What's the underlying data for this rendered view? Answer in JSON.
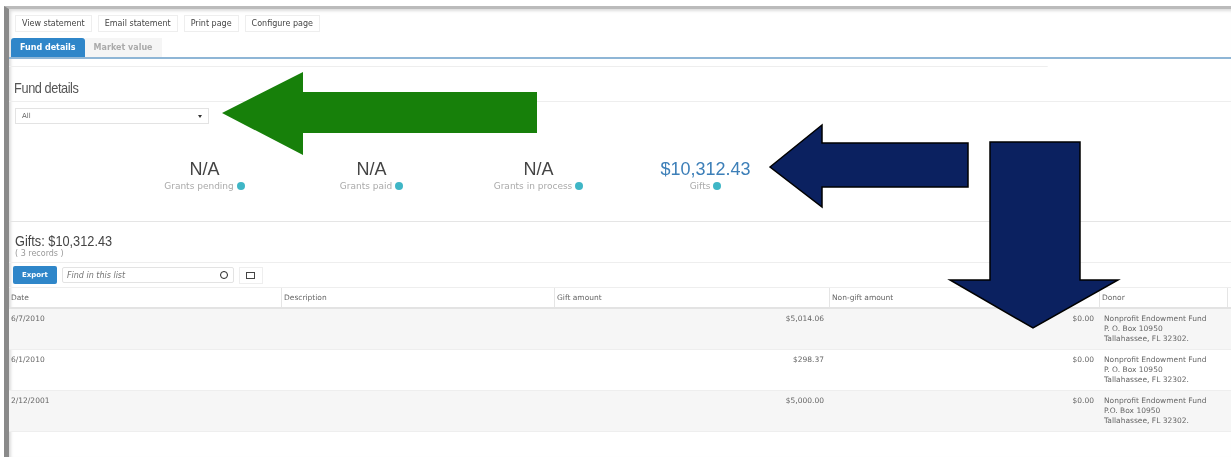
{
  "toolbar": [
    "View statement",
    "Email statement",
    "Print page",
    "Configure page"
  ],
  "tabs": [
    {
      "label": "Fund details",
      "selected": true
    },
    {
      "label": "Market value",
      "selected": false
    }
  ],
  "section_title": "Fund details",
  "filter": {
    "value": "All"
  },
  "summary": [
    {
      "value": "N/A",
      "label": "Grants pending",
      "highlight": false
    },
    {
      "value": "N/A",
      "label": "Grants paid",
      "highlight": false
    },
    {
      "value": "N/A",
      "label": "Grants in process",
      "highlight": false
    },
    {
      "value": "$10,312.43",
      "label": "Gifts",
      "highlight": true
    }
  ],
  "list": {
    "title": "Gifts: $10,312.43",
    "count": "( 3 records )",
    "export": "Export",
    "search": {
      "placeholder": "Find in this list"
    }
  },
  "table": {
    "columns": [
      "Date",
      "Description",
      "Gift amount",
      "Non-gift amount",
      "Donor"
    ],
    "rows": [
      {
        "date": "6/7/2010",
        "gift": "$5,014.06",
        "nongift": "$0.00",
        "donor": [
          "Nonprofit Endowment Fund",
          "P. O. Box 10950",
          "Tallahassee, FL 32302."
        ]
      },
      {
        "date": "6/1/2010",
        "gift": "$298.37",
        "nongift": "$0.00",
        "donor": [
          "Nonprofit Endowment Fund",
          "P. O. Box 10950",
          "Tallahassee, FL 32302."
        ]
      },
      {
        "date": "2/12/2001",
        "gift": "$5,000.00",
        "nongift": "$0.00",
        "donor": [
          "Nonprofit Endowment Fund",
          "P.O. Box 10950",
          "Tallahassee, FL 32302."
        ]
      }
    ]
  },
  "annotations": [
    {
      "kind": "left-arrow",
      "color": "#17800a"
    },
    {
      "kind": "left-arrow",
      "color": "#0b2160"
    },
    {
      "kind": "down-arrow",
      "color": "#0b2160"
    }
  ]
}
